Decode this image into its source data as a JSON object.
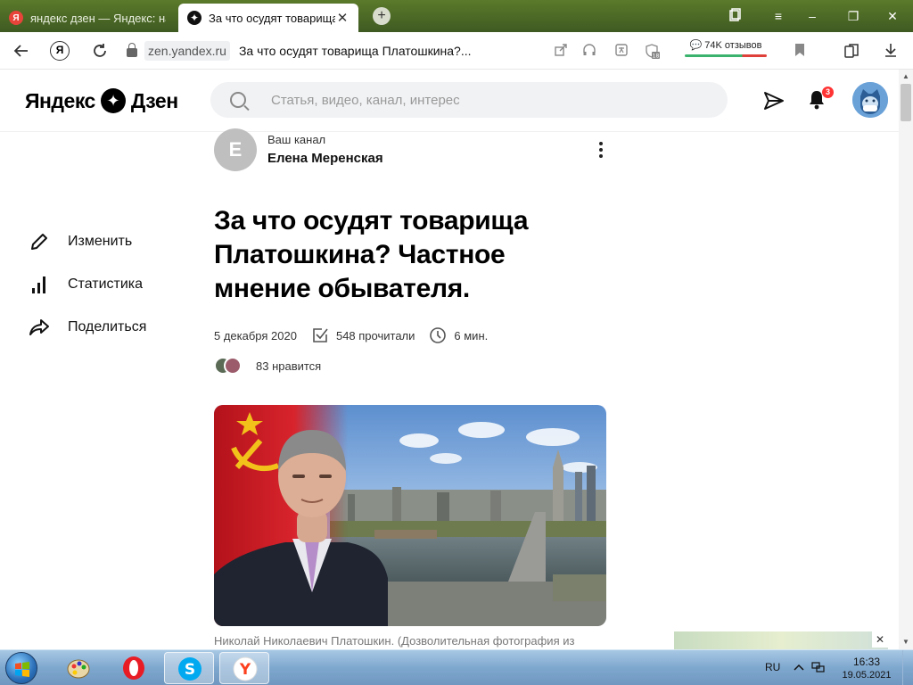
{
  "browser": {
    "tabs": [
      {
        "title": "яндекс дзен — Яндекс: нашлось",
        "icon_letter": "Я",
        "active": false
      },
      {
        "title": "За что осудят товарища Пл",
        "icon_letter": "✦",
        "active": true
      }
    ],
    "new_tab_label": "+",
    "url_domain": "zen.yandex.ru",
    "url_title": "За что осудят товарища Платошкина?...",
    "reviews_label": "74K отзывов",
    "ya_button": "Я",
    "badge_18": "18"
  },
  "header": {
    "logo_left": "Яндекс",
    "logo_right": "Дзен",
    "search_placeholder": "Статья, видео, канал, интерес",
    "notifications_count": "3"
  },
  "sidebar": {
    "items": [
      {
        "label": "Изменить",
        "icon": "pencil-icon"
      },
      {
        "label": "Статистика",
        "icon": "stats-icon"
      },
      {
        "label": "Поделиться",
        "icon": "share-icon"
      }
    ]
  },
  "channel": {
    "avatar_letter": "Е",
    "label": "Ваш канал",
    "name": "Елена Меренская"
  },
  "article": {
    "title": "За что осудят товарища Платошкина? Частное мнение обывателя.",
    "date": "5 декабря 2020",
    "reads": "548 прочитали",
    "read_time": "6 мин.",
    "likes": "83 нравится",
    "caption": "Николай Николаевич Платошкин. (Дозволительная фотография из"
  },
  "taskbar": {
    "language": "RU",
    "time": "16:33",
    "date": "19.05.2021"
  },
  "colors": {
    "tabstrip": "#4a6a26",
    "accent_red": "#ff3333",
    "search_bg": "#f1f2f4"
  }
}
